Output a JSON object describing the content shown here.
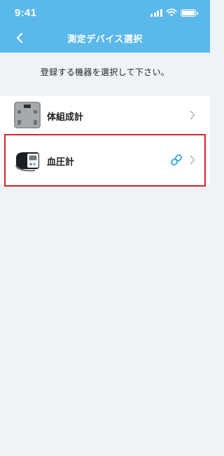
{
  "status_bar": {
    "time": "9:41",
    "icons": [
      "cellular-signal-icon",
      "wifi-icon",
      "battery-icon"
    ]
  },
  "nav": {
    "title": "測定デバイス選択",
    "back_icon": "chevron-left-icon"
  },
  "instruction": "登録する機器を選択して下さい。",
  "devices": [
    {
      "label": "体組成計",
      "icon": "body-composition-scale-icon",
      "linked": false
    },
    {
      "label": "血圧計",
      "icon": "blood-pressure-monitor-icon",
      "linked": true
    }
  ],
  "colors": {
    "header": "#5bb8ea",
    "background": "#eef3f7",
    "link_icon": "#3aa4e0",
    "highlight": "#d42727"
  }
}
